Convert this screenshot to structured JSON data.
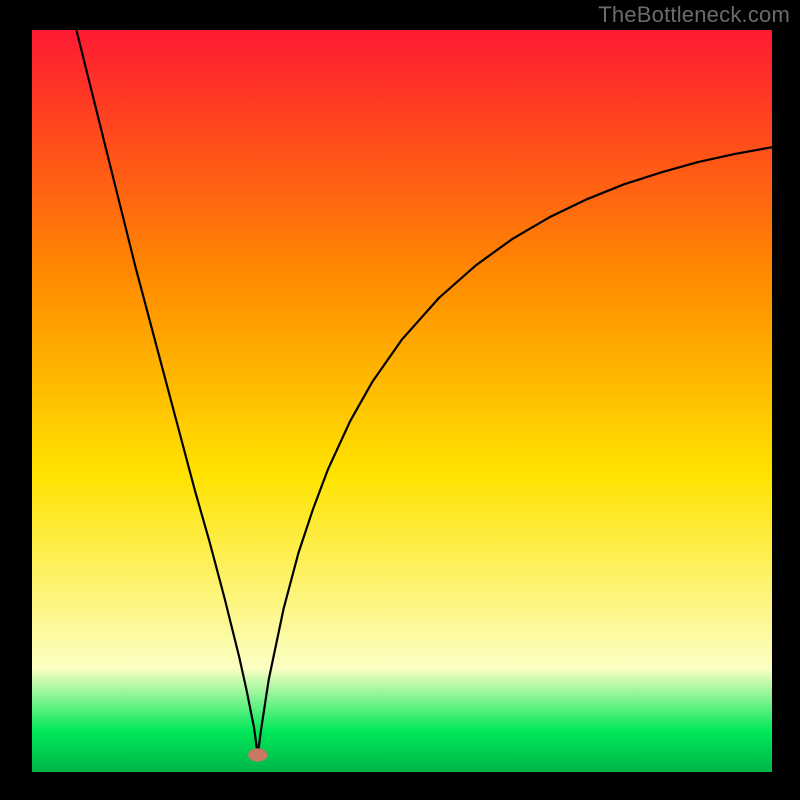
{
  "watermark": "TheBottleneck.com",
  "chart_data": {
    "type": "line",
    "title": "",
    "xlabel": "",
    "ylabel": "",
    "xlim": [
      0,
      100
    ],
    "ylim": [
      0,
      100
    ],
    "gradient_colors": {
      "top": "#ff1a33",
      "mid_upper": "#ff8a00",
      "mid": "#ffe300",
      "pale": "#fcffc4",
      "green": "#00e85a",
      "green_deep": "#00b548"
    },
    "marker": {
      "x": 30.5,
      "y": 2.3,
      "color": "#c77863",
      "rx": 1.3,
      "ry": 0.9
    },
    "series": [
      {
        "name": "bottleneck-curve",
        "x": [
          6,
          8,
          10,
          12,
          14,
          16,
          18,
          20,
          22,
          24,
          26,
          28,
          29,
          30,
          30.5,
          31,
          32,
          34,
          36,
          38,
          40,
          43,
          46,
          50,
          55,
          60,
          65,
          70,
          75,
          80,
          85,
          90,
          95,
          100
        ],
        "y": [
          100,
          92,
          84,
          76,
          68,
          60.5,
          53,
          45.5,
          38,
          31,
          23.5,
          15.5,
          11,
          6,
          2.3,
          6,
          12.5,
          22,
          29.5,
          35.5,
          40.8,
          47.3,
          52.6,
          58.3,
          63.9,
          68.3,
          71.9,
          74.8,
          77.2,
          79.2,
          80.8,
          82.2,
          83.3,
          84.2
        ]
      }
    ]
  }
}
